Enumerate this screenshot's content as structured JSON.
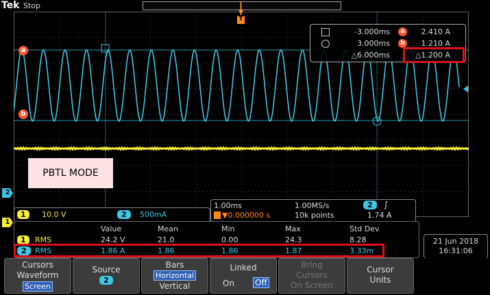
{
  "header": {
    "brand": "Tek",
    "run_state": "Stop"
  },
  "colors": {
    "ch1": "#f5ef3a",
    "ch2": "#3ec8e6",
    "cursor_marker": "#ff5a32",
    "trigger": "#ff8a1a",
    "highlight": "#e0101a"
  },
  "cursor_readout": {
    "row1": {
      "time": "-3.000ms",
      "marker": "a",
      "value": "2.410 A"
    },
    "row2": {
      "time": "3.000ms",
      "marker": "b",
      "value": "1.210 A"
    },
    "row3": {
      "time": "△6.000ms",
      "value": "△1.200 A"
    }
  },
  "waveform_labels": {
    "cursor_a": "a",
    "cursor_b": "b",
    "trigger": "T",
    "ch1_ground": "1",
    "ch2_ground": "2"
  },
  "annotation": {
    "mode_label": "PBTL MODE"
  },
  "channel_settings": {
    "ch1_badge": "1",
    "ch1_scale": "10.0 V",
    "ch2_badge": "2",
    "ch2_scale": "500mA"
  },
  "timebase": {
    "time_per_div": "1.00ms",
    "sample_rate": "1.00MS/s",
    "trigger_pos": "▼0.000000 s",
    "record_length": "10k points",
    "trigger_source": "2",
    "trigger_level": "1.74 A"
  },
  "measurements": {
    "headers": [
      "Value",
      "Mean",
      "Min",
      "Max",
      "Std Dev"
    ],
    "rows": [
      {
        "ch": "1",
        "type": "RMS",
        "value": "24.2 V",
        "mean": "21.0",
        "min": "0.00",
        "max": "24.3",
        "std": "8.28"
      },
      {
        "ch": "2",
        "type": "RMS",
        "value": "1.86 A",
        "mean": "1.86",
        "min": "1.86",
        "max": "1.87",
        "std": "3.33m"
      }
    ]
  },
  "datetime": {
    "date": "21 Jun  2018",
    "time": "16:31:06"
  },
  "menu": {
    "b1": {
      "l1": "Cursors",
      "l2": "Waveform",
      "l3": "Screen"
    },
    "b2": {
      "l1": "Source",
      "l2": "2"
    },
    "b3": {
      "l1": "Bars",
      "l2": "Horizontal",
      "l3": "Vertical"
    },
    "b4": {
      "l1": "Linked",
      "l2": "On",
      "l3": "Off"
    },
    "b5": {
      "l1": "Bring",
      "l2": "Cursors",
      "l3": "On Screen"
    },
    "b6": {
      "l1": "Cursor",
      "l2": "Units"
    }
  }
}
